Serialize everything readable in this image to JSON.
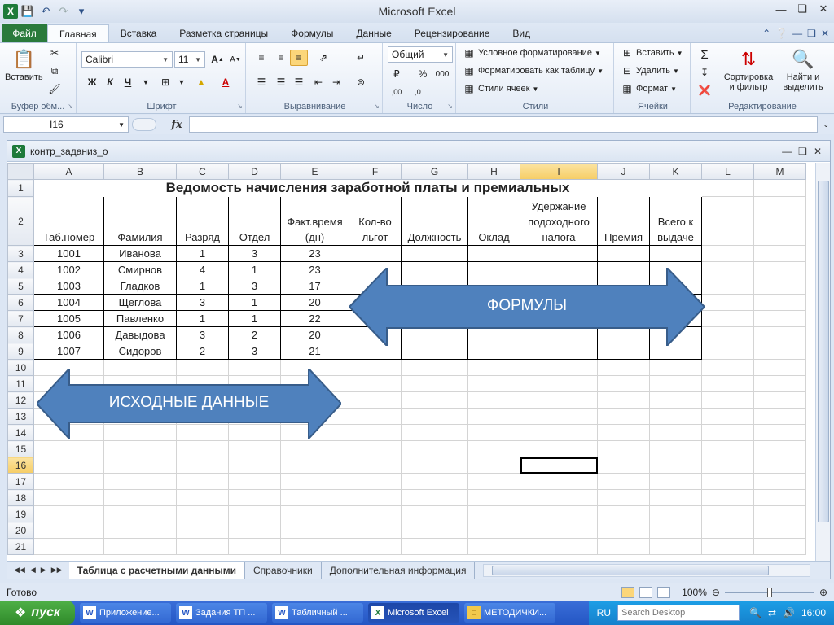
{
  "app": {
    "title": "Microsoft Excel"
  },
  "ribbon_tabs": [
    "Файл",
    "Главная",
    "Вставка",
    "Разметка страницы",
    "Формулы",
    "Данные",
    "Рецензирование",
    "Вид"
  ],
  "ribbon": {
    "clipboard": {
      "label": "Буфер обм...",
      "paste": "Вставить"
    },
    "font": {
      "label": "Шрифт",
      "name": "Calibri",
      "size": "11",
      "bold": "Ж",
      "italic": "К",
      "underline": "Ч"
    },
    "alignment": {
      "label": "Выравнивание"
    },
    "number": {
      "label": "Число",
      "format": "Общий"
    },
    "styles": {
      "label": "Стили",
      "conditional": "Условное форматирование",
      "as_table": "Форматировать как таблицу",
      "cell_styles": "Стили ячеек"
    },
    "cells": {
      "label": "Ячейки",
      "insert": "Вставить",
      "delete": "Удалить",
      "format": "Формат"
    },
    "editing": {
      "label": "Редактирование",
      "sort": "Сортировка и фильтр",
      "find": "Найти и выделить"
    }
  },
  "formula_bar": {
    "name_box": "I16",
    "fx": "fx",
    "value": ""
  },
  "workbook": {
    "title": "контр_заданиз_о"
  },
  "columns": [
    "A",
    "B",
    "C",
    "D",
    "E",
    "F",
    "G",
    "H",
    "I",
    "J",
    "K",
    "L",
    "M"
  ],
  "sheet": {
    "title": "Ведомость начисления заработной платы и премиальных",
    "headers": {
      "A": "Таб.номер",
      "B": "Фамилия",
      "C": "Разряд",
      "D": "Отдел",
      "E": "Факт.время (дн)",
      "F": "Кол-во льгот",
      "G": "Должность",
      "H": "Оклад",
      "I": "Удержание подоходного налога",
      "J": "Премия",
      "K": "Всего к выдаче"
    },
    "rows": [
      {
        "tab": "1001",
        "name": "Иванова",
        "grade": "1",
        "dept": "3",
        "time": "23"
      },
      {
        "tab": "1002",
        "name": "Смирнов",
        "grade": "4",
        "dept": "1",
        "time": "23"
      },
      {
        "tab": "1003",
        "name": "Гладков",
        "grade": "1",
        "dept": "3",
        "time": "17"
      },
      {
        "tab": "1004",
        "name": "Щеглова",
        "grade": "3",
        "dept": "1",
        "time": "20"
      },
      {
        "tab": "1005",
        "name": "Павленко",
        "grade": "1",
        "dept": "1",
        "time": "22"
      },
      {
        "tab": "1006",
        "name": "Давыдова",
        "grade": "3",
        "dept": "2",
        "time": "20"
      },
      {
        "tab": "1007",
        "name": "Сидоров",
        "grade": "2",
        "dept": "3",
        "time": "21"
      }
    ]
  },
  "annotations": {
    "formulas": "ФОРМУЛЫ",
    "source_data": "ИСХОДНЫЕ ДАННЫЕ"
  },
  "sheet_tabs": [
    "Таблица с расчетными данными",
    "Справочники",
    "Дополнительная информация"
  ],
  "status": {
    "ready": "Готово",
    "zoom": "100%"
  },
  "taskbar": {
    "start": "пуск",
    "tasks": [
      "Приложение...",
      "Задания ТП ...",
      "Табличный ...",
      "Microsoft Excel",
      "МЕТОДИЧКИ..."
    ],
    "lang": "RU",
    "search_placeholder": "Search Desktop",
    "clock": "16:00"
  },
  "colors": {
    "arrow_fill": "#4f81bd",
    "arrow_stroke": "#385d8a",
    "file_tab": "#2a7a3b",
    "selected_header": "#f6cd66"
  }
}
